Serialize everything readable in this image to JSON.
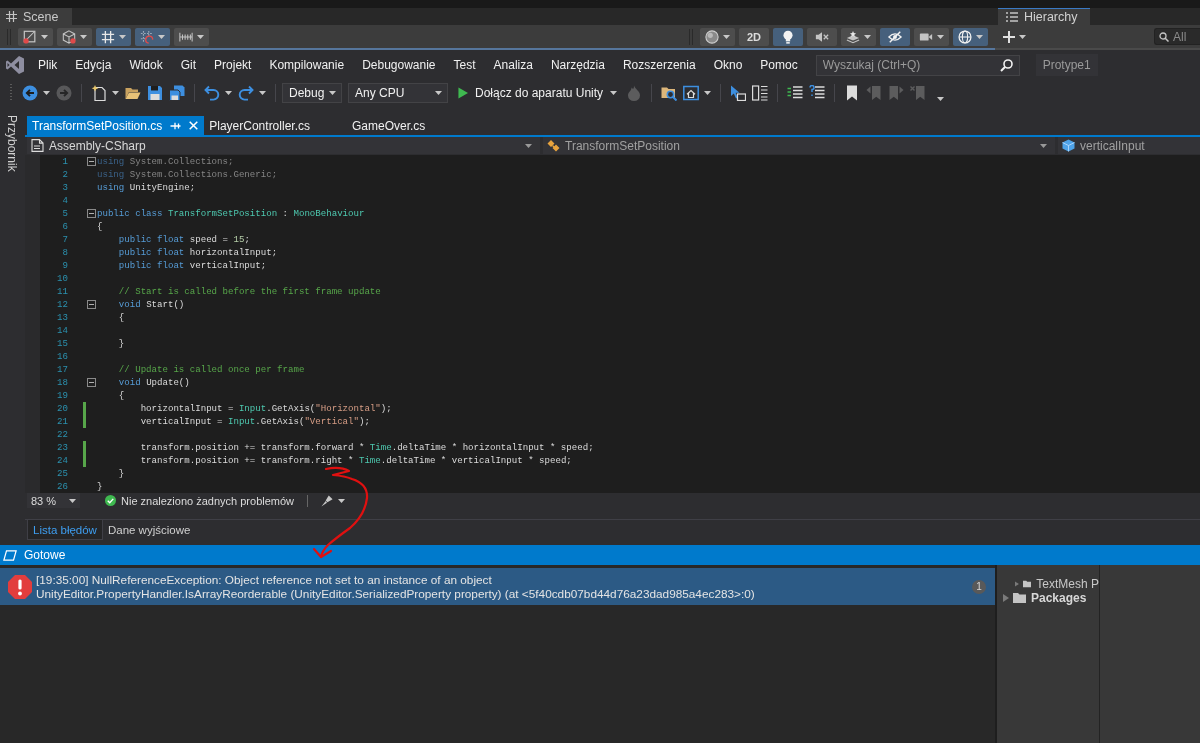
{
  "unity": {
    "scene_tab": "Scene",
    "scene_toolbar": {
      "left": [
        {
          "on": false
        },
        {
          "on": false
        },
        {
          "on": true
        },
        {
          "on": true
        },
        {
          "on": false
        }
      ],
      "right": [
        {
          "on": false
        },
        {
          "label": "2D",
          "on": false
        },
        {
          "on": true
        },
        {
          "on": false
        },
        {
          "on": false
        },
        {
          "on": true
        },
        {
          "on": false
        },
        {
          "on": true
        }
      ]
    },
    "hierarchy": {
      "title": "Hierarchy",
      "search": {
        "placeholder": "All"
      }
    }
  },
  "menu_bar": {
    "menus": [
      "Plik",
      "Edycja",
      "Widok",
      "Git",
      "Projekt",
      "Kompilowanie",
      "Debugowanie",
      "Test",
      "Analiza",
      "Narzędzia",
      "Rozszerzenia",
      "Okno",
      "Pomoc"
    ],
    "search": {
      "placeholder": "Wyszukaj (Ctrl+Q)"
    },
    "solution": "Protype1"
  },
  "toolbar": {
    "groups": [
      [
        {
          "kind": "icon",
          "disabled": false
        },
        {
          "kind": "icon",
          "disabled": true
        }
      ],
      [
        {
          "kind": "icon",
          "disabled": false
        },
        {
          "kind": "icon",
          "disabled": false
        },
        {
          "kind": "icon",
          "disabled": false
        },
        {
          "kind": "icon",
          "disabled": false
        }
      ],
      [
        {
          "kind": "icon",
          "disabled": false
        },
        {
          "kind": "icon",
          "disabled": false
        }
      ],
      [
        {
          "kind": "dropdown",
          "label": "Debug"
        },
        {
          "kind": "dropdown",
          "label": "Any CPU"
        },
        {
          "kind": "run",
          "label": "Dołącz do aparatu Unity"
        },
        {
          "kind": "icon",
          "disabled": true
        }
      ],
      [
        {
          "kind": "icon",
          "disabled": false
        },
        {
          "kind": "icon",
          "disabled": false
        }
      ],
      [
        {
          "kind": "icon",
          "disabled": false
        },
        {
          "kind": "icon",
          "disabled": false
        }
      ],
      [
        {
          "kind": "icon",
          "disabled": false
        },
        {
          "kind": "icon",
          "disabled": false
        }
      ],
      [
        {
          "kind": "icon",
          "disabled": false
        },
        {
          "kind": "icon",
          "disabled": true
        },
        {
          "kind": "icon",
          "disabled": true
        },
        {
          "kind": "icon",
          "disabled": true
        }
      ]
    ]
  },
  "sidebar": {
    "tab": "Przybornik"
  },
  "editor": {
    "tabs": [
      {
        "label": "TransformSetPosition.cs",
        "selected": true
      },
      {
        "label": "PlayerController.cs",
        "selected": false
      },
      {
        "label": "GameOver.cs",
        "selected": false
      }
    ],
    "navigation": [
      "Assembly-CSharp",
      "TransformSetPosition",
      "verticalInput"
    ],
    "code_lines": [
      {
        "number": "1",
        "changed": false,
        "fold": true,
        "faded": true,
        "tokens": [
          {
            "kind": "keyword",
            "text": "using"
          },
          {
            "kind": "plain",
            "text": " System.Collections;"
          }
        ]
      },
      {
        "number": "2",
        "changed": false,
        "fold": false,
        "faded": true,
        "tokens": [
          {
            "kind": "keyword",
            "text": "using"
          },
          {
            "kind": "plain",
            "text": " System.Collections.Generic;"
          }
        ]
      },
      {
        "number": "3",
        "changed": false,
        "fold": false,
        "faded": false,
        "tokens": [
          {
            "kind": "keyword",
            "text": "using"
          },
          {
            "kind": "plain",
            "text": " UnityEngine;"
          }
        ]
      },
      {
        "number": "4",
        "changed": false,
        "fold": false
      },
      {
        "number": "5",
        "changed": false,
        "fold": true,
        "faded": false,
        "tokens": [
          {
            "kind": "keyword",
            "text": "public class "
          },
          {
            "kind": "type",
            "text": "TransformSetPosition"
          },
          {
            "kind": "plain",
            "text": " : "
          },
          {
            "kind": "type",
            "text": "MonoBehaviour"
          }
        ]
      },
      {
        "number": "6",
        "changed": false,
        "fold": false,
        "faded": false,
        "tokens": [
          {
            "kind": "plain",
            "text": "{"
          }
        ]
      },
      {
        "number": "7",
        "changed": false,
        "fold": false,
        "faded": false,
        "tokens": [
          {
            "kind": "keyword",
            "text": "    public float"
          },
          {
            "kind": "plain",
            "text": " speed = "
          },
          {
            "kind": "number",
            "text": "15"
          },
          {
            "kind": "plain",
            "text": ";"
          }
        ]
      },
      {
        "number": "8",
        "changed": false,
        "fold": false,
        "faded": false,
        "tokens": [
          {
            "kind": "keyword",
            "text": "    public float"
          },
          {
            "kind": "plain",
            "text": " horizontalInput;"
          }
        ]
      },
      {
        "number": "9",
        "changed": false,
        "fold": false,
        "faded": false,
        "tokens": [
          {
            "kind": "keyword",
            "text": "    public float"
          },
          {
            "kind": "plain",
            "text": " verticalInput;"
          }
        ]
      },
      {
        "number": "10",
        "changed": false,
        "fold": false
      },
      {
        "number": "11",
        "changed": false,
        "fold": false,
        "faded": false,
        "tokens": [
          {
            "kind": "comment",
            "text": "    // Start is called before the first frame update"
          }
        ]
      },
      {
        "number": "12",
        "changed": false,
        "fold": true,
        "faded": false,
        "tokens": [
          {
            "kind": "keyword",
            "text": "    void"
          },
          {
            "kind": "plain",
            "text": " Start()"
          }
        ]
      },
      {
        "number": "13",
        "changed": false,
        "fold": false,
        "faded": false,
        "tokens": [
          {
            "kind": "plain",
            "text": "    {"
          }
        ]
      },
      {
        "number": "14",
        "changed": false,
        "fold": false
      },
      {
        "number": "15",
        "changed": false,
        "fold": false,
        "faded": false,
        "tokens": [
          {
            "kind": "plain",
            "text": "    }"
          }
        ]
      },
      {
        "number": "16",
        "changed": false,
        "fold": false
      },
      {
        "number": "17",
        "changed": false,
        "fold": false,
        "faded": false,
        "tokens": [
          {
            "kind": "comment",
            "text": "    // Update is called once per frame"
          }
        ]
      },
      {
        "number": "18",
        "changed": false,
        "fold": true,
        "faded": false,
        "tokens": [
          {
            "kind": "keyword",
            "text": "    void"
          },
          {
            "kind": "plain",
            "text": " Update()"
          }
        ]
      },
      {
        "number": "19",
        "changed": false,
        "fold": false,
        "faded": false,
        "tokens": [
          {
            "kind": "plain",
            "text": "    {"
          }
        ]
      },
      {
        "number": "20",
        "changed": true,
        "fold": false,
        "faded": false,
        "tokens": [
          {
            "kind": "plain",
            "text": "        horizontalInput = "
          },
          {
            "kind": "type",
            "text": "Input"
          },
          {
            "kind": "plain",
            "text": ".GetAxis("
          },
          {
            "kind": "string",
            "text": "\"Horizontal\""
          },
          {
            "kind": "plain",
            "text": ");"
          }
        ]
      },
      {
        "number": "21",
        "changed": true,
        "fold": false,
        "faded": false,
        "tokens": [
          {
            "kind": "plain",
            "text": "        verticalInput = "
          },
          {
            "kind": "type",
            "text": "Input"
          },
          {
            "kind": "plain",
            "text": ".GetAxis("
          },
          {
            "kind": "string",
            "text": "\"Vertical\""
          },
          {
            "kind": "plain",
            "text": ");"
          }
        ]
      },
      {
        "number": "22",
        "changed": false,
        "fold": false
      },
      {
        "number": "23",
        "changed": true,
        "fold": false,
        "faded": false,
        "tokens": [
          {
            "kind": "plain",
            "text": "        transform.position += transform.forward * "
          },
          {
            "kind": "type",
            "text": "Time"
          },
          {
            "kind": "plain",
            "text": ".deltaTime * horizontalInput * speed;"
          }
        ]
      },
      {
        "number": "24",
        "changed": true,
        "fold": false,
        "faded": false,
        "tokens": [
          {
            "kind": "plain",
            "text": "        transform.position += transform.right * "
          },
          {
            "kind": "type",
            "text": "Time"
          },
          {
            "kind": "plain",
            "text": ".deltaTime * verticalInput * speed;"
          }
        ]
      },
      {
        "number": "25",
        "changed": false,
        "fold": false,
        "faded": false,
        "tokens": [
          {
            "kind": "plain",
            "text": "    }"
          }
        ]
      },
      {
        "number": "26",
        "changed": false,
        "fold": false,
        "faded": false,
        "tokens": [
          {
            "kind": "plain",
            "text": "}"
          }
        ]
      }
    ],
    "zoom": "83 %",
    "issues": "Nie znaleziono żadnych problemów",
    "panel_tabs": [
      {
        "label": "Lista błędów",
        "selected": true
      },
      {
        "label": "Dane wyjściowe",
        "selected": false
      }
    ]
  },
  "status_bar": {
    "message": "Gotowe"
  },
  "console": {
    "entries": [
      {
        "selected": true,
        "message": "[19:35:00] NullReferenceException: Object reference not set to an instance of an object",
        "trace": "UnityEditor.PropertyHandler.IsArrayReorderable (UnityEditor.SerializedProperty property) (at <5f40cdb07bd44d76a23dad985a4ec283>:0)",
        "count": "1"
      }
    ]
  },
  "project_tree": [
    {
      "children": [
        {
          "label": "TextMesh P",
          "expanded": false
        }
      ]
    },
    {
      "label": "Packages",
      "expanded": false
    }
  ]
}
